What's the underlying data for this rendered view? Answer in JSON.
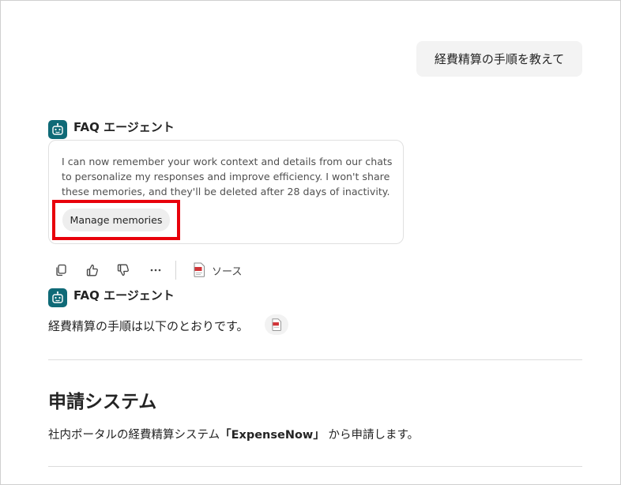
{
  "conversation": {
    "user_message": "経費精算の手順を教えて",
    "agent_name": "FAQ エージェント",
    "memory_card": {
      "text": "I can now remember your work context and details from our chats to personalize my responses and improve efficiency. I won't share these memories, and they'll be deleted after 28 days of inactivity.",
      "button_label": "Manage memories"
    },
    "actions": {
      "copy_icon": "copy-icon",
      "like_icon": "thumbs-up-icon",
      "dislike_icon": "thumbs-down-icon",
      "more_icon": "more-icon",
      "source_label": "ソース"
    },
    "answer": {
      "intro": "経費精算の手順は以下のとおりです。",
      "section_heading": "申請システム",
      "section_text_prefix": "社内ポータルの経費精算システム",
      "section_text_highlight": "「ExpenseNow」",
      "section_text_suffix": " から申請します。"
    }
  },
  "colors": {
    "agent_avatar": "#0f6a77",
    "highlight_border": "#e8000b",
    "user_bubble_bg": "#f3f3f3"
  }
}
